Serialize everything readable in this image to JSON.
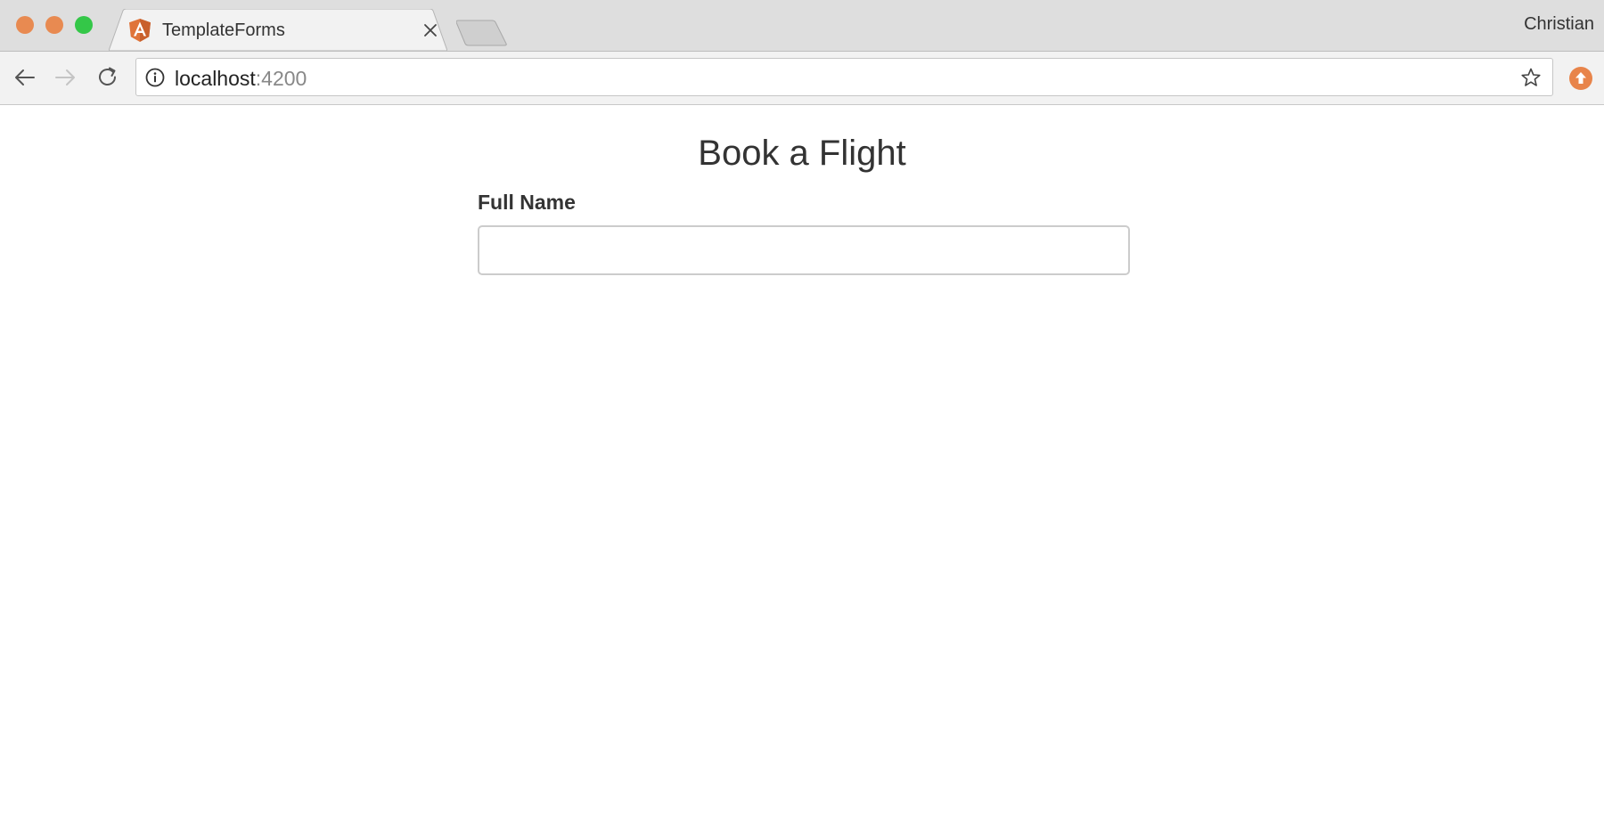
{
  "browser": {
    "tab": {
      "title": "TemplateForms",
      "favicon": "angular-logo-icon"
    },
    "profile_name": "Christian",
    "address_bar": {
      "host": "localhost",
      "port": ":4200"
    },
    "colors": {
      "traffic_close": "#e88a51",
      "traffic_minimize": "#e88a51",
      "traffic_maximize": "#34c748",
      "favicon": "#e0743a",
      "extension": "#e8844a"
    }
  },
  "page": {
    "title": "Book a Flight",
    "form": {
      "full_name_label": "Full Name",
      "full_name_value": "",
      "full_name_placeholder": ""
    }
  }
}
